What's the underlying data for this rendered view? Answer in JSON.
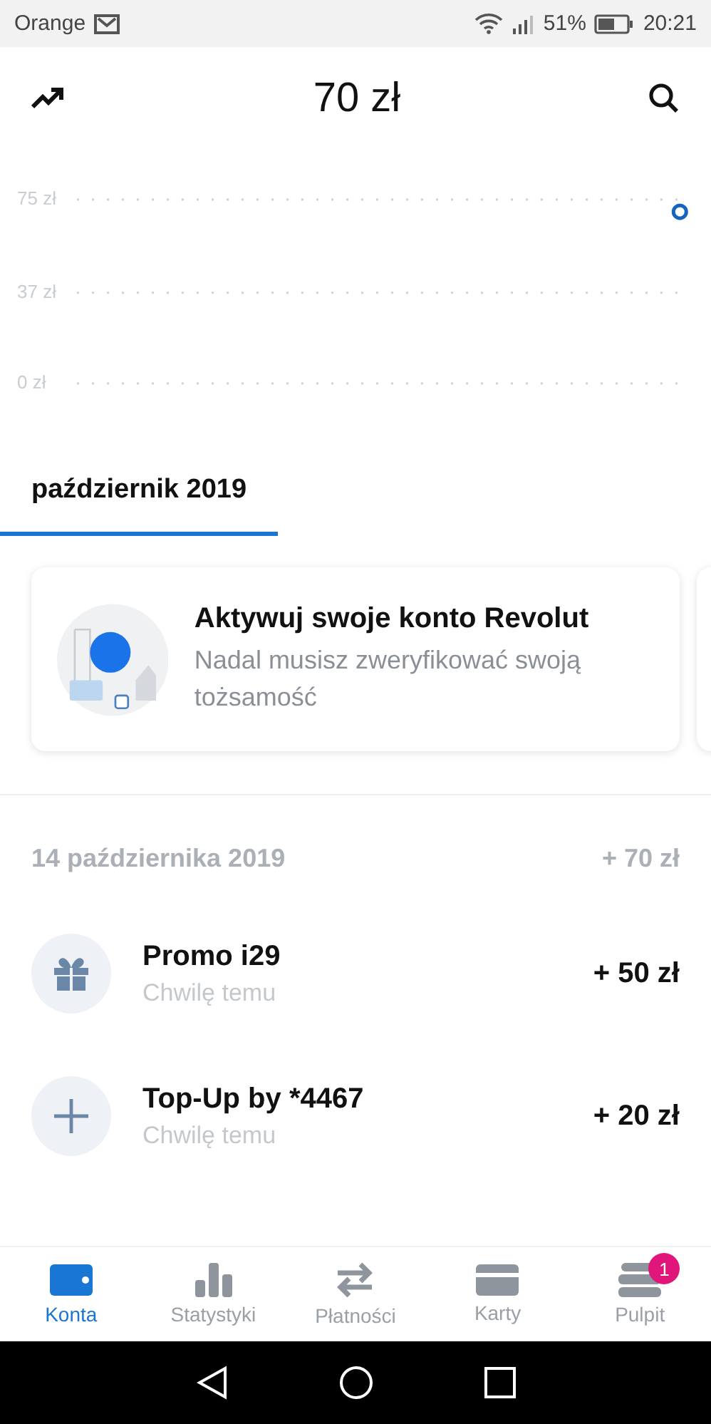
{
  "status_bar": {
    "carrier": "Orange",
    "battery_text": "51%",
    "time": "20:21"
  },
  "header": {
    "balance": "70 zł"
  },
  "chart": {
    "chart_data": {
      "type": "scatter",
      "categories": [
        null,
        null,
        null,
        null,
        null,
        null,
        null,
        null,
        null,
        null,
        null,
        null,
        null,
        null,
        null,
        null,
        null,
        null,
        null,
        null
      ],
      "values": [
        null,
        null,
        null,
        null,
        null,
        null,
        null,
        null,
        null,
        null,
        null,
        null,
        null,
        null,
        null,
        null,
        null,
        null,
        null,
        70
      ],
      "ylim": [
        0,
        75
      ],
      "yticks": [
        {
          "value": 75,
          "label": "75 zł"
        },
        {
          "value": 37,
          "label": "37 zł"
        },
        {
          "value": 0,
          "label": "0 zł"
        }
      ]
    }
  },
  "tabs": [
    {
      "label": "październik 2019",
      "selected": true
    }
  ],
  "promo_card": {
    "title": "Aktywuj swoje konto Revolut",
    "subtitle": "Nadal musisz zweryfikować swoją tożsamość"
  },
  "transactions": {
    "date": "14 października 2019",
    "total": "+ 70 zł",
    "items": [
      {
        "kind": "gift",
        "title": "Promo i29",
        "time": "Chwilę temu",
        "amount": "+ 50 zł"
      },
      {
        "kind": "topup",
        "title": "Top-Up by *4467",
        "time": "Chwilę temu",
        "amount": "+ 20 zł"
      }
    ]
  },
  "bottom_nav": [
    {
      "kind": "wallet",
      "label": "Konta",
      "selected": true
    },
    {
      "kind": "stats",
      "label": "Statystyki",
      "selected": false
    },
    {
      "kind": "transfer",
      "label": "Płatności",
      "selected": false
    },
    {
      "kind": "card",
      "label": "Karty",
      "selected": false
    },
    {
      "kind": "dashboard",
      "label": "Pulpit",
      "selected": false,
      "badge": "1"
    }
  ]
}
